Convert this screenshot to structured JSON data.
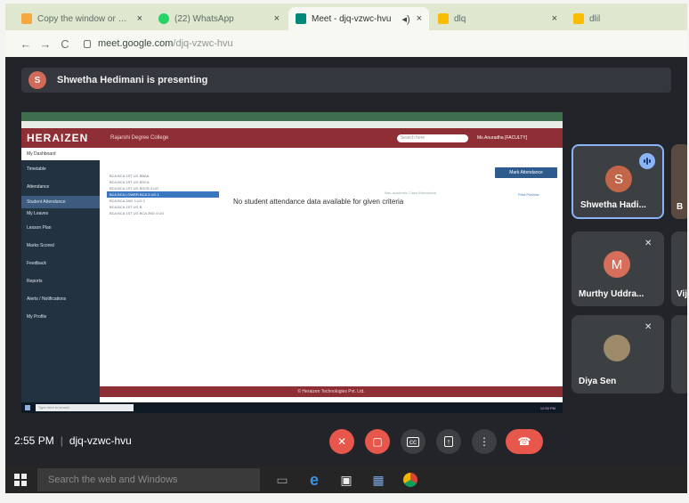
{
  "browser": {
    "tabs": [
      {
        "title": "Copy the window or scr...",
        "favicon_color": "#f4a940",
        "active": false
      },
      {
        "title": "(22) WhatsApp",
        "favicon_color": "#25d366",
        "active": false
      },
      {
        "title": "Meet - djq-vzwc-hvu",
        "favicon_color": "#00897b",
        "active": true
      },
      {
        "title": "dlq",
        "favicon_color": "#fbbc04",
        "active": false
      },
      {
        "title": "dlil",
        "favicon_color": "#fbbc04",
        "active": false
      }
    ],
    "url_host": "meet.google.com",
    "url_path": "/djq-vzwc-hvu"
  },
  "meet": {
    "presenter_initial": "S",
    "presenting_text": "Shwetha Hedimani is presenting",
    "shared_screen": {
      "logo": "HERAIZEN",
      "college": "Rajarshi Degree College",
      "search_placeholder": "Search here",
      "user": "Ms.Anuradha [FACULTY]",
      "sidebar": [
        "My Dashboard",
        "Timetable",
        "Attendance",
        "Student Attendance",
        "My Leaves",
        "Lesson Plan",
        "Marks Scored",
        "Feedback",
        "Reports",
        "Alerts / Notifications",
        "My Profile"
      ],
      "dropdown": [
        "BCA BCA 1ST UG BBAA",
        "BCA BCA 1ST UG BSCA",
        "BCA BCA 1ST UG BSCB 3 UG",
        "BCA BCA LOWER BCA 3 UG 1",
        "BCA BCA 2ND 3 UG 1",
        "BCA BCA 1ST UG B",
        "BCA BCA 1ST UG BCA 2ND 4 UG"
      ],
      "mark_button": "Mark Attendance",
      "legend": "Non-academic Class  Attendance",
      "print": "Print Preview",
      "message": "No student attendance data available for given criteria",
      "footer": "© Heraizen Technologies Pvt. Ltd.",
      "taskbar_search": "Type here to search",
      "clock": "12:55 PM"
    },
    "tiles": [
      {
        "name": "Shwetha Hadi...",
        "initial": "S",
        "color": "#c26548",
        "active": true
      },
      {
        "name": "Murthy Uddra...",
        "initial": "M",
        "color": "#d56e5a",
        "active": false
      },
      {
        "name": "Diya Sen",
        "initial": "",
        "color": "#9c8a6a",
        "active": false
      }
    ],
    "edge_labels": [
      "B",
      "Vij"
    ],
    "time": "2:55 PM",
    "meeting_code": "djq-vzwc-hvu"
  },
  "windows": {
    "search_placeholder": "Search the web and Windows"
  },
  "colors": {
    "accent": "#8ab4f8",
    "danger": "#e8574b",
    "heraizen": "#8e2e35"
  }
}
